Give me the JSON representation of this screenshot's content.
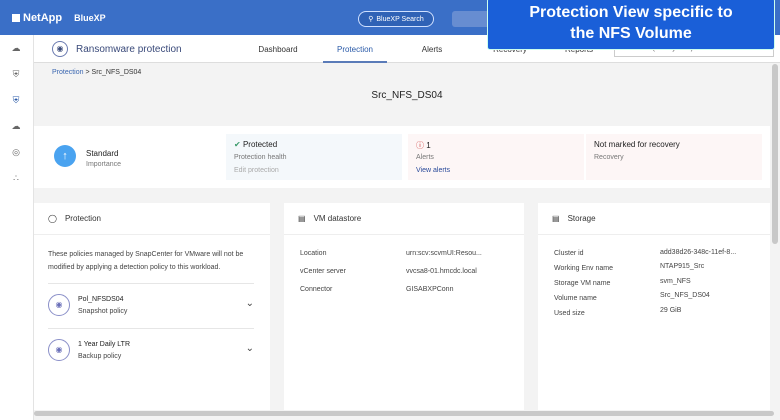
{
  "topbar": {
    "brand": "NetApp",
    "product": "BlueXP",
    "search": "BlueXP Search"
  },
  "app": {
    "title": "Ransomware protection",
    "tabs": [
      "Dashboard",
      "Protection",
      "Alerts",
      "Recovery",
      "Reports"
    ],
    "trial": "Free trial (30 days left) - View details"
  },
  "breadcrumb": {
    "parent": "Protection",
    "sep": ">",
    "current": "Src_NFS_DS04"
  },
  "page_title": "Src_NFS_DS04",
  "summary": {
    "importance": {
      "value": "Standard",
      "label": "Importance"
    },
    "health": {
      "value": "Protected",
      "label": "Protection health",
      "action": "Edit protection"
    },
    "alerts": {
      "value": "1",
      "label": "Alerts",
      "action": "View alerts"
    },
    "recovery": {
      "value": "Not marked for recovery",
      "label": "Recovery"
    }
  },
  "protection": {
    "title": "Protection",
    "note": "These policies managed by SnapCenter for VMware will not be modified by applying a detection policy to this workload.",
    "policies": [
      {
        "name": "Pol_NFSDS04",
        "type": "Snapshot policy"
      },
      {
        "name": "1 Year Daily LTR",
        "type": "Backup policy"
      }
    ]
  },
  "datastore": {
    "title": "VM datastore",
    "rows": [
      {
        "k": "Location",
        "v": "urn:scv:scvmUI:Resou..."
      },
      {
        "k": "vCenter server",
        "v": "vvcsa8-01.hmcdc.local"
      },
      {
        "k": "Connector",
        "v": "GISABXPConn"
      }
    ]
  },
  "storage": {
    "title": "Storage",
    "rows": [
      {
        "k": "Cluster id",
        "v": "add38d26-348c-11ef-8..."
      },
      {
        "k": "Working Env name",
        "v": "NTAP915_Src"
      },
      {
        "k": "Storage VM name",
        "v": "svm_NFS"
      },
      {
        "k": "Volume name",
        "v": "Src_NFS_DS04"
      },
      {
        "k": "Used size",
        "v": "29 GiB"
      }
    ]
  },
  "callout": {
    "line1": "Protection View specific to",
    "line2": "the NFS Volume"
  }
}
